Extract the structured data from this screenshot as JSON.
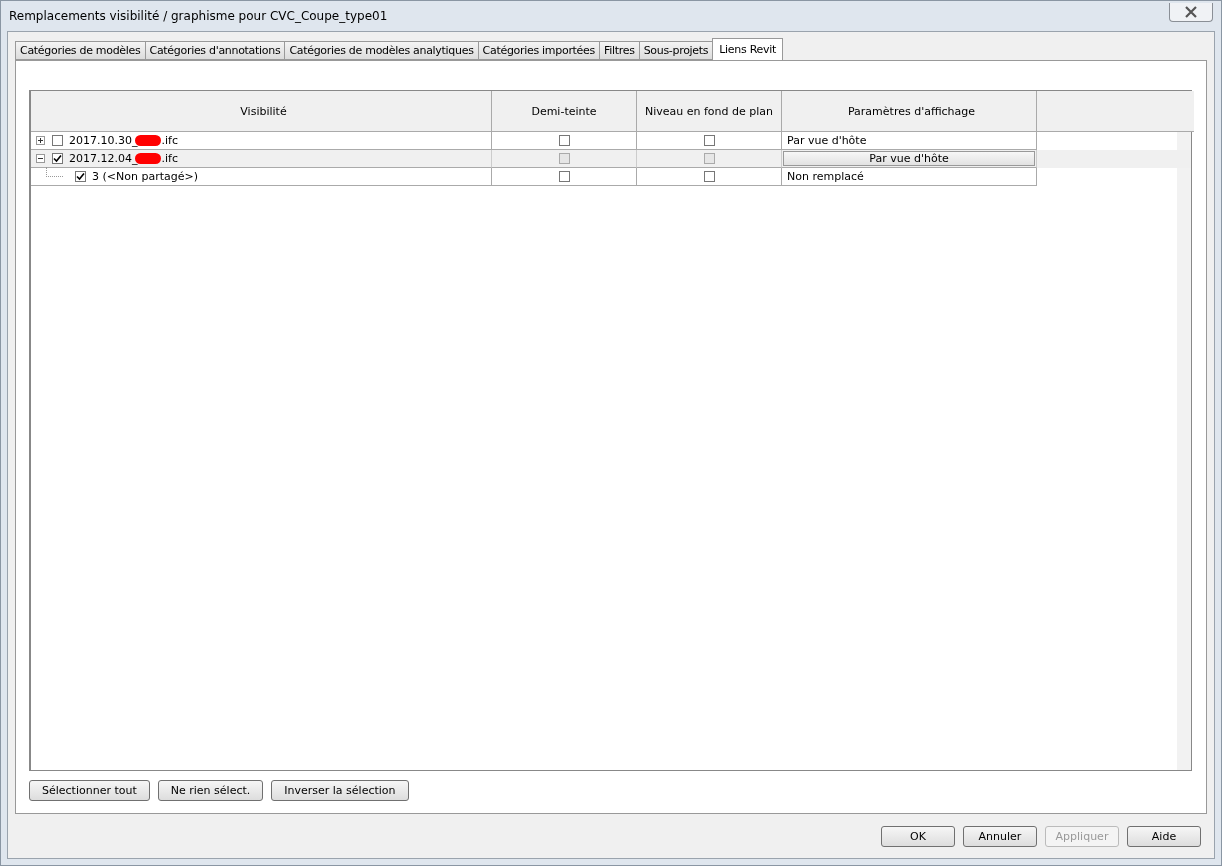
{
  "window": {
    "title": "Remplacements visibilité / graphisme pour CVC_Coupe_type01"
  },
  "tabs": [
    {
      "label": "Catégories de modèles",
      "selected": false
    },
    {
      "label": "Catégories d'annotations",
      "selected": false
    },
    {
      "label": "Catégories de modèles analytiques",
      "selected": false
    },
    {
      "label": "Catégories importées",
      "selected": false
    },
    {
      "label": "Filtres",
      "selected": false
    },
    {
      "label": "Sous-projets",
      "selected": false
    },
    {
      "label": "Liens Revit",
      "selected": true
    }
  ],
  "table": {
    "columns": [
      "Visibilité",
      "Demi-teinte",
      "Niveau en fond de plan",
      "Paramètres d'affichage"
    ],
    "rows": [
      {
        "label_start": "2017.10.30_",
        "label_end": ".ifc",
        "redacted": true,
        "visible": false,
        "halftone": false,
        "underlay": false,
        "display": "Par vue d'hôte",
        "selected": false,
        "expanded": false
      },
      {
        "label_start": "2017.12.04_",
        "label_end": ".ifc",
        "redacted": true,
        "visible": true,
        "halftone": false,
        "underlay": false,
        "display": "Par vue d'hôte",
        "selected": true,
        "expanded": true,
        "children": [
          {
            "label_start": "3 (<Non partagé>)",
            "visible": true,
            "halftone": false,
            "underlay": false,
            "display": "Non remplacé",
            "selected": false
          }
        ]
      }
    ]
  },
  "selection_buttons": [
    "Sélectionner tout",
    "Ne rien sélect.",
    "Inverser la sélection"
  ],
  "dialog_buttons": [
    {
      "label": "OK",
      "disabled": false
    },
    {
      "label": "Annuler",
      "disabled": false
    },
    {
      "label": "Appliquer",
      "disabled": true
    },
    {
      "label": "Aide",
      "disabled": false
    }
  ]
}
